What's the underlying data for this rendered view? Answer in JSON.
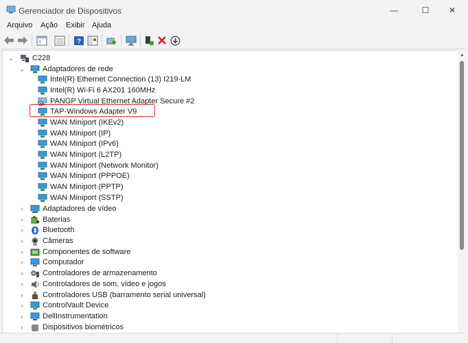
{
  "window": {
    "title": "Gerenciador de Dispositivos",
    "minimize_glyph": "—",
    "maximize_glyph": "☐",
    "close_glyph": "✕"
  },
  "menu": [
    {
      "label": "Arquivo"
    },
    {
      "label": "Ação"
    },
    {
      "label": "Exibir"
    },
    {
      "label": "Ajuda"
    }
  ],
  "toolbar": {
    "icons": [
      "back-arrow-icon",
      "forward-arrow-icon",
      "properties-view-icon",
      "device-list-icon",
      "help-icon",
      "show-hidden-icon",
      "scan-hardware-icon",
      "monitor-icon",
      "enable-device-icon",
      "uninstall-x-icon",
      "update-driver-icon"
    ]
  },
  "tree": {
    "root": {
      "label": "C228",
      "expander": "⌄"
    },
    "network_category": {
      "label": "Adaptadores de rede",
      "expander": "⌄"
    },
    "network_adapters": [
      {
        "label": "Intel(R) Ethernet Connection (13) I219-LM"
      },
      {
        "label": "Intel(R) Wi-Fi 6 AX201 160MHz"
      },
      {
        "label": "PANGP Virtual Ethernet Adapter Secure #2"
      },
      {
        "label": "TAP-Windows Adapter V9"
      },
      {
        "label": "WAN Miniport (IKEv2)"
      },
      {
        "label": "WAN Miniport (IP)"
      },
      {
        "label": "WAN Miniport (IPv6)"
      },
      {
        "label": "WAN Miniport (L2TP)"
      },
      {
        "label": "WAN Miniport (Network Monitor)"
      },
      {
        "label": "WAN Miniport (PPPOE)"
      },
      {
        "label": "WAN Miniport (PPTP)"
      },
      {
        "label": "WAN Miniport (SSTP)"
      }
    ],
    "categories": [
      {
        "label": "Adaptadores de vídeo",
        "expander": "›"
      },
      {
        "label": "Baterias",
        "expander": "›"
      },
      {
        "label": "Bluetooth",
        "expander": "›"
      },
      {
        "label": "Câmeras",
        "expander": "›"
      },
      {
        "label": "Componentes de software",
        "expander": "›"
      },
      {
        "label": "Computador",
        "expander": "›"
      },
      {
        "label": "Controladores de armazenamento",
        "expander": "›"
      },
      {
        "label": "Controladores de som, vídeo e jogos",
        "expander": "›"
      },
      {
        "label": "Controladores USB (barramento serial universal)",
        "expander": "›"
      },
      {
        "label": "ControlVault Device",
        "expander": "›"
      },
      {
        "label": "DellInstrumentation",
        "expander": "›"
      },
      {
        "label": "Dispositivos biométricos",
        "expander": "›"
      }
    ]
  },
  "colors": {
    "highlight_border": "#d3232b",
    "accent": "#0a64c8"
  }
}
